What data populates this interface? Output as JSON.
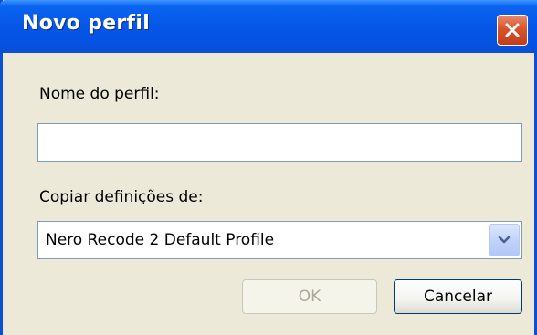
{
  "window": {
    "title": "Novo perfil",
    "close_icon": "close-icon"
  },
  "form": {
    "profile_name_label": "Nome do perfil:",
    "profile_name_value": "",
    "copy_settings_label": "Copiar definições de:",
    "copy_settings_selected": "Nero Recode 2 Default Profile",
    "dropdown_icon": "chevron-down-icon"
  },
  "buttons": {
    "ok_label": "OK",
    "ok_enabled": false,
    "cancel_label": "Cancelar"
  },
  "colors": {
    "titlebar": "#0656e8",
    "dialog_background": "#ece9d8",
    "close_button": "#d9542c",
    "input_border": "#7f9db9"
  }
}
